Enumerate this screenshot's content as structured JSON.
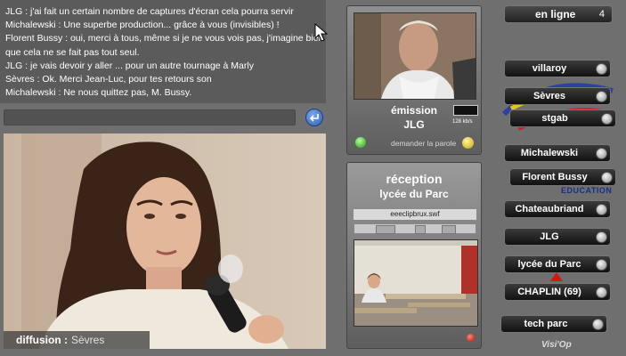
{
  "chat": {
    "lines": [
      "JLG : j'ai fait un certain nombre de captures d'écran cela pourra servir",
      "Michalewski : Une superbe production... grâce à vous (invisibles) !",
      "Florent Bussy : oui, merci à tous, même si je ne vous vois pas, j'imagine bien",
      "que cela ne se fait pas tout seul.",
      "JLG : je vais devoir y aller ... pour un autre tournage à Marly",
      "Sèvres : Ok. Merci Jean-Luc, pour tes retours son",
      "Michalewski : Ne nous quittez pas, M. Bussy."
    ],
    "input_value": ""
  },
  "broadcast": {
    "label": "diffusion :",
    "source": "Sèvres"
  },
  "emission": {
    "label": "émission",
    "user": "JLG",
    "bitrate": "128 kb/s",
    "ask_speak": "demander la parole"
  },
  "reception": {
    "label": "réception",
    "site": "lycée du Parc",
    "filename": "eeeclipbrux.swf"
  },
  "online": {
    "label": "en ligne",
    "count": "4"
  },
  "users": [
    "villaroy",
    "Sèvres",
    "stgab",
    "Michalewski",
    "Florent Bussy",
    "Chateaubriand",
    "JLG",
    "lycée du Parc",
    "CHAPLIN (69)",
    "tech parc"
  ],
  "logos": {
    "education": "EDUCATION",
    "visiop": "Visi'Op"
  },
  "colors": {
    "background": "#6f6f6f",
    "chat_bg": "#5b5b5b",
    "led_green": "#1e9a12",
    "led_yellow": "#c7a400",
    "led_red": "#b30f00",
    "education_blue": "#1c2f86"
  }
}
